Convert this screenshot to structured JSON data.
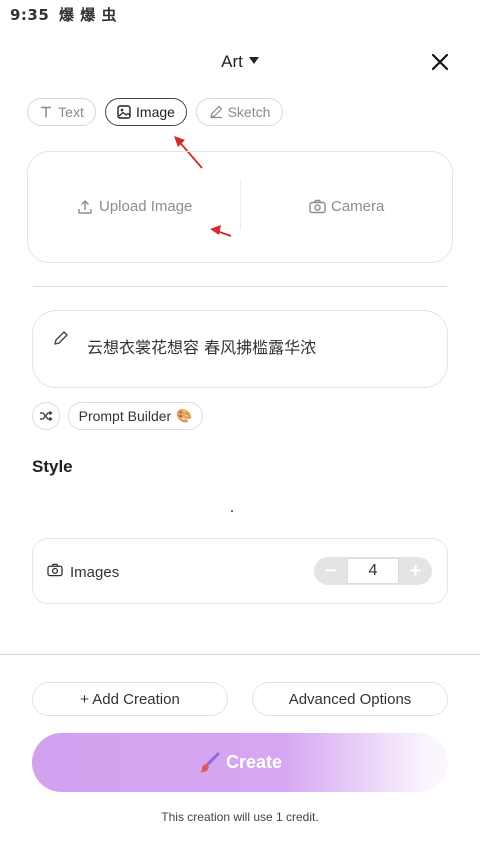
{
  "status_bar": {
    "time": "9:35",
    "icons": "爆 爆 虫"
  },
  "header": {
    "title": "Art",
    "dropdown_icon": "caret-down-icon",
    "close_icon": "close-icon"
  },
  "tabs": [
    {
      "label": "Text",
      "icon": "text-icon",
      "active": false
    },
    {
      "label": "Image",
      "icon": "image-icon",
      "active": true
    },
    {
      "label": "Sketch",
      "icon": "pencil-icon",
      "active": false
    }
  ],
  "upload": {
    "upload_label": "Upload Image",
    "upload_icon": "upload-icon",
    "camera_label": "Camera",
    "camera_icon": "camera-icon"
  },
  "prompt": {
    "text": "云想衣裳花想容 春风拂槛露华浓",
    "icon": "pencil-icon"
  },
  "prompt_tools": {
    "shuffle_icon": "shuffle-icon",
    "builder_label": "Prompt Builder",
    "builder_emoji": "🎨"
  },
  "style": {
    "heading": "Style"
  },
  "images": {
    "label": "Images",
    "icon": "camera-icon",
    "count": "4",
    "minus": "−",
    "plus": "+"
  },
  "actions": {
    "add_creation": "+ Add Creation",
    "advanced_options": "Advanced Options"
  },
  "create": {
    "label": "Create",
    "icon": "paintbrush-icon",
    "gradient_start": "#d2a2f0",
    "gradient_end": "#fbf5fd"
  },
  "footer": {
    "credit_note": "This creation will use 1 credit."
  },
  "colors": {
    "annotation_arrow": "#d42a2a"
  }
}
